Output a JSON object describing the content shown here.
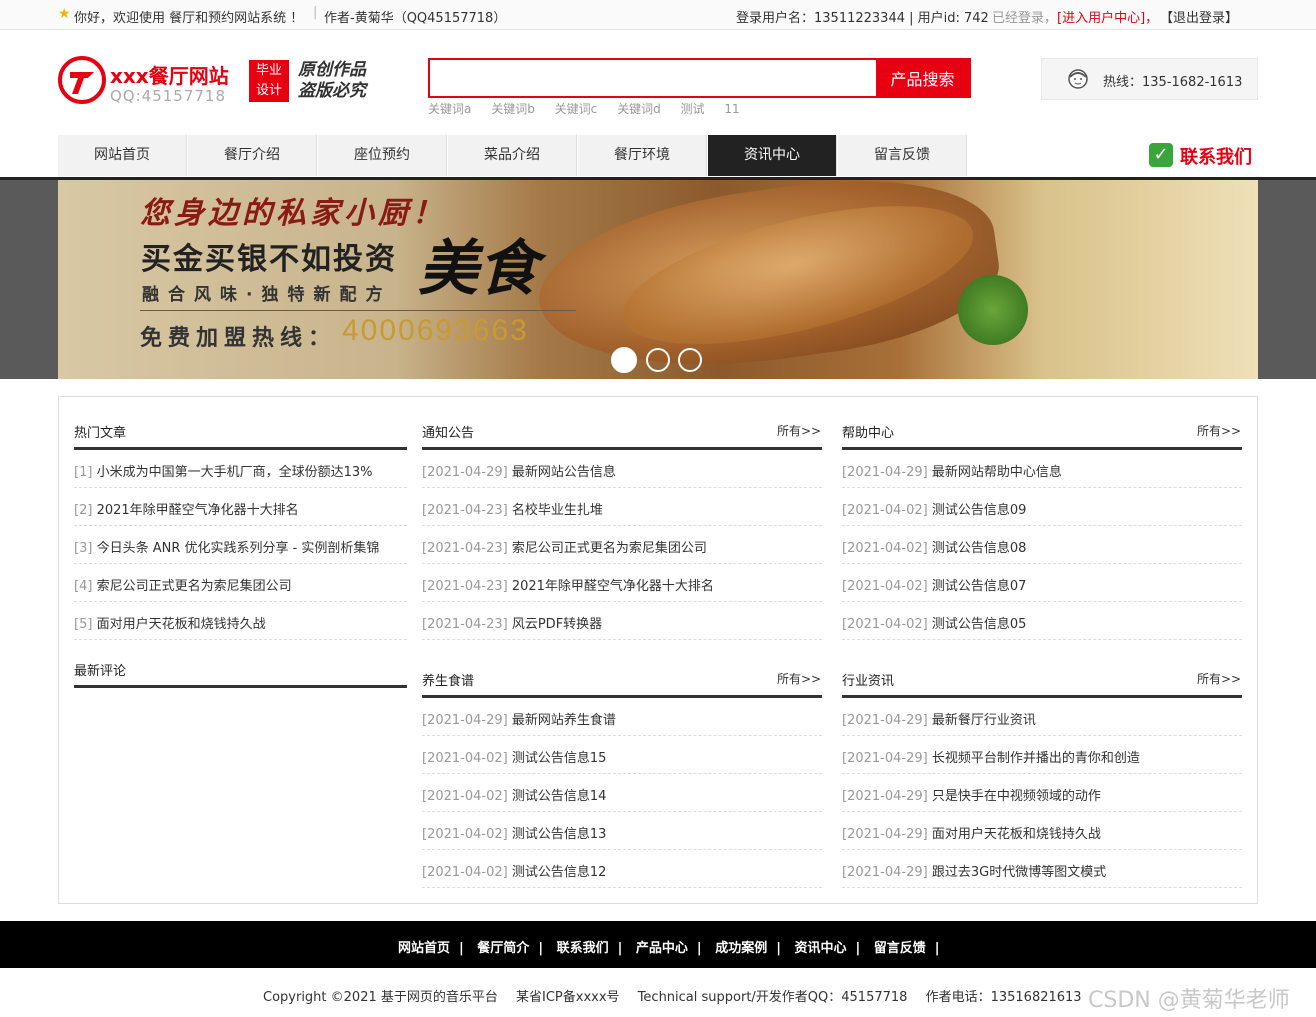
{
  "topbar": {
    "welcome": "你好，欢迎使用 餐厅和预约网站系统 ！",
    "author": "作者-黄菊华（QQ45157718）",
    "login_info": "登录用户名：13511223344 | 用户id: 742",
    "logged_in": "已经登录，",
    "enter_center": "[进入用户中心]，",
    "logout": "【退出登录】"
  },
  "header": {
    "site_title": "xxx餐厅网站",
    "site_qq": "QQ:45157718",
    "badge_line1": "毕业",
    "badge_line2": "设计",
    "slogan_line1": "原创作品",
    "slogan_line2": "盗版必究",
    "search_placeholder": "",
    "search_button": "产品搜索",
    "keywords": [
      "关键词a",
      "关键词b",
      "关键词c",
      "关键词d",
      "测试",
      "11"
    ],
    "hotline": "热线：135-1682-1613"
  },
  "nav": {
    "items": [
      "网站首页",
      "餐厅介绍",
      "座位预约",
      "菜品介绍",
      "餐厅环境",
      "资讯中心",
      "留言反馈"
    ],
    "active_index": 5,
    "contact": "联系我们"
  },
  "banner": {
    "line1": "您身边的私家小厨！",
    "line2": "买金买银不如投资",
    "line3": "融合风味·独特新配方",
    "big_word": "美食",
    "hotline_label": "免费加盟热线：",
    "hotline_number": "4000693663",
    "slides": 3,
    "active_slide": 0
  },
  "sections": {
    "hot": {
      "title": "热门文章",
      "items": [
        {
          "pre": "[1]",
          "text": "小米成为中国第一大手机厂商，全球份额达13%"
        },
        {
          "pre": "[2]",
          "text": "2021年除甲醛空气净化器十大排名"
        },
        {
          "pre": "[3]",
          "text": "今日头条 ANR 优化实践系列分享 - 实例剖析集锦"
        },
        {
          "pre": "[4]",
          "text": "索尼公司正式更名为索尼集团公司"
        },
        {
          "pre": "[5]",
          "text": "面对用户天花板和烧钱持久战"
        }
      ]
    },
    "comments": {
      "title": "最新评论"
    },
    "notice": {
      "title": "通知公告",
      "more": "所有>>",
      "items": [
        {
          "pre": "[2021-04-29]",
          "text": "最新网站公告信息"
        },
        {
          "pre": "[2021-04-23]",
          "text": "名校毕业生扎堆"
        },
        {
          "pre": "[2021-04-23]",
          "text": "索尼公司正式更名为索尼集团公司"
        },
        {
          "pre": "[2021-04-23]",
          "text": "2021年除甲醛空气净化器十大排名"
        },
        {
          "pre": "[2021-04-23]",
          "text": "风云PDF转换器"
        }
      ]
    },
    "help": {
      "title": "帮助中心",
      "more": "所有>>",
      "items": [
        {
          "pre": "[2021-04-29]",
          "text": "最新网站帮助中心信息"
        },
        {
          "pre": "[2021-04-02]",
          "text": "测试公告信息09"
        },
        {
          "pre": "[2021-04-02]",
          "text": "测试公告信息08"
        },
        {
          "pre": "[2021-04-02]",
          "text": "测试公告信息07"
        },
        {
          "pre": "[2021-04-02]",
          "text": "测试公告信息05"
        }
      ]
    },
    "recipes": {
      "title": "养生食谱",
      "more": "所有>>",
      "items": [
        {
          "pre": "[2021-04-29]",
          "text": "最新网站养生食谱"
        },
        {
          "pre": "[2021-04-02]",
          "text": "测试公告信息15"
        },
        {
          "pre": "[2021-04-02]",
          "text": "测试公告信息14"
        },
        {
          "pre": "[2021-04-02]",
          "text": "测试公告信息13"
        },
        {
          "pre": "[2021-04-02]",
          "text": "测试公告信息12"
        }
      ]
    },
    "industry": {
      "title": "行业资讯",
      "more": "所有>>",
      "items": [
        {
          "pre": "[2021-04-29]",
          "text": "最新餐厅行业资讯"
        },
        {
          "pre": "[2021-04-29]",
          "text": "长视频平台制作并播出的青你和创造"
        },
        {
          "pre": "[2021-04-29]",
          "text": "只是快手在中视频领域的动作"
        },
        {
          "pre": "[2021-04-29]",
          "text": "面对用户天花板和烧钱持久战"
        },
        {
          "pre": "[2021-04-29]",
          "text": "跟过去3G时代微博等图文模式"
        }
      ]
    }
  },
  "footer": {
    "links": [
      "网站首页",
      "餐厅简介",
      "联系我们",
      "产品中心",
      "成功案例",
      "资讯中心",
      "留言反馈"
    ],
    "separator": "|",
    "copyright": "Copyright ©2021 基于网页的音乐平台",
    "icp": "某省ICP备xxxx号",
    "support": "Technical support/开发作者QQ：45157718",
    "phone": "作者电话：13516821613",
    "watermark": "CSDN @黄菊华老师"
  },
  "colors": {
    "accent": "#e60012",
    "nav_active": "#222222",
    "footer_bg": "#000000"
  }
}
